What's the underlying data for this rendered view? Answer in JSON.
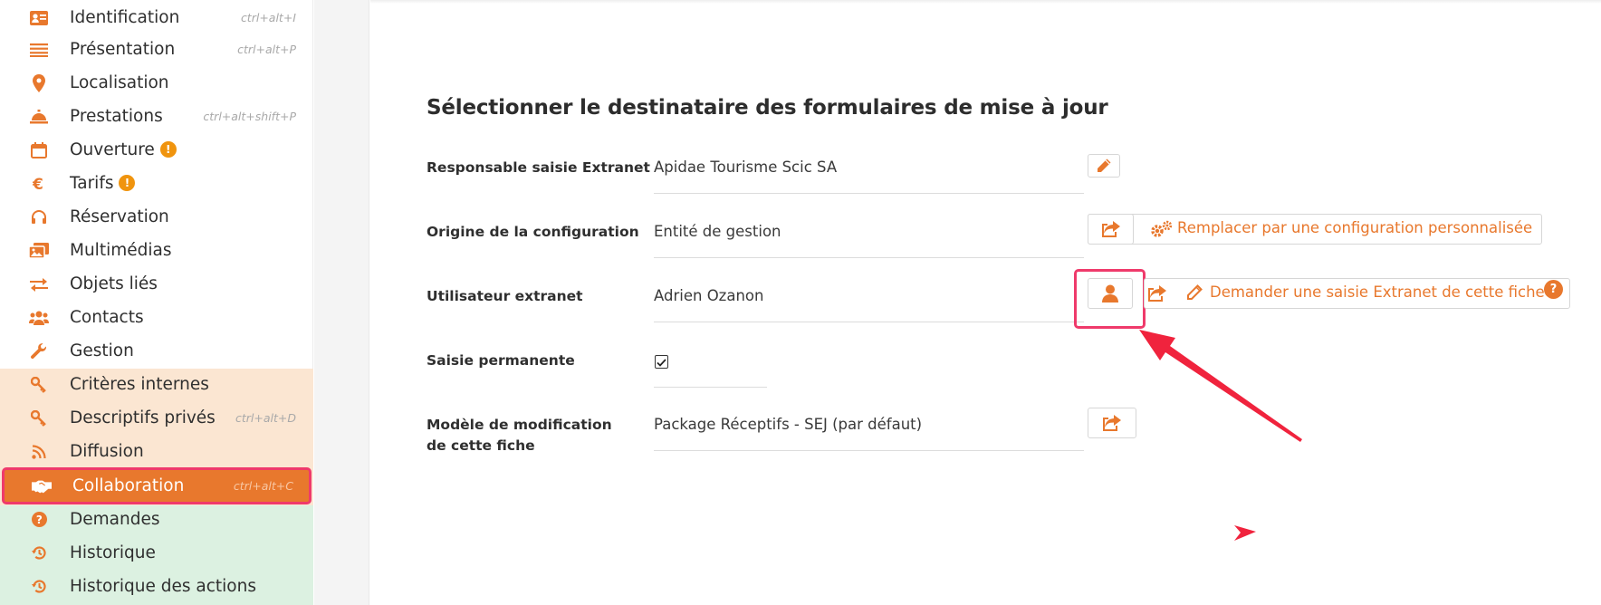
{
  "sidebar": {
    "items": [
      {
        "label": "Identification",
        "shortcut": "ctrl+alt+I",
        "icon": "id-card-icon"
      },
      {
        "label": "Présentation",
        "shortcut": "ctrl+alt+P",
        "icon": "list-lines-icon"
      },
      {
        "label": "Localisation",
        "shortcut": "",
        "icon": "map-pin-icon"
      },
      {
        "label": "Prestations",
        "shortcut": "ctrl+alt+shift+P",
        "icon": "service-bell-icon"
      },
      {
        "label": "Ouverture",
        "shortcut": "",
        "icon": "calendar-icon",
        "warning": "!"
      },
      {
        "label": "Tarifs",
        "shortcut": "",
        "icon": "euro-icon",
        "warning": "!"
      },
      {
        "label": "Réservation",
        "shortcut": "",
        "icon": "headset-icon"
      },
      {
        "label": "Multimédias",
        "shortcut": "",
        "icon": "images-icon"
      },
      {
        "label": "Objets liés",
        "shortcut": "",
        "icon": "exchange-arrows-icon"
      },
      {
        "label": "Contacts",
        "shortcut": "",
        "icon": "users-icon"
      },
      {
        "label": "Gestion",
        "shortcut": "",
        "icon": "wrench-icon"
      },
      {
        "label": "Critères internes",
        "shortcut": "",
        "icon": "key-icon"
      },
      {
        "label": "Descriptifs privés",
        "shortcut": "ctrl+alt+D",
        "icon": "key-icon"
      },
      {
        "label": "Diffusion",
        "shortcut": "",
        "icon": "rss-icon"
      },
      {
        "label": "Collaboration",
        "shortcut": "ctrl+alt+C",
        "icon": "handshake-icon",
        "active": true
      },
      {
        "label": "Demandes",
        "shortcut": "",
        "icon": "question-circle-icon"
      },
      {
        "label": "Historique",
        "shortcut": "",
        "icon": "history-icon"
      },
      {
        "label": "Historique des actions",
        "shortcut": "",
        "icon": "history-icon"
      }
    ]
  },
  "main": {
    "title": "Sélectionner le destinataire des formulaires de mise à jour",
    "fields": {
      "responsable": {
        "label": "Responsable saisie Extranet",
        "value": "Apidae Tourisme Scic SA"
      },
      "origine": {
        "label": "Origine de la configuration",
        "value": "Entité de gestion",
        "action": "Remplacer par une configuration personnalisée"
      },
      "utilisateur": {
        "label": "Utilisateur extranet",
        "value": "Adrien Ozanon",
        "action": "Demander une saisie Extranet de cette fiche",
        "help": "?"
      },
      "saisie": {
        "label": "Saisie permanente",
        "checked": true
      },
      "modele": {
        "label": "Modèle de modification de cette fiche",
        "value": "Package Réceptifs - SEJ (par défaut)"
      }
    }
  },
  "colors": {
    "accent": "#e8782d",
    "highlight": "#ef3a6b",
    "annotation_arrow": "#f0233d",
    "band_peach": "#fbe6d2",
    "band_green": "#dcf1e1"
  }
}
